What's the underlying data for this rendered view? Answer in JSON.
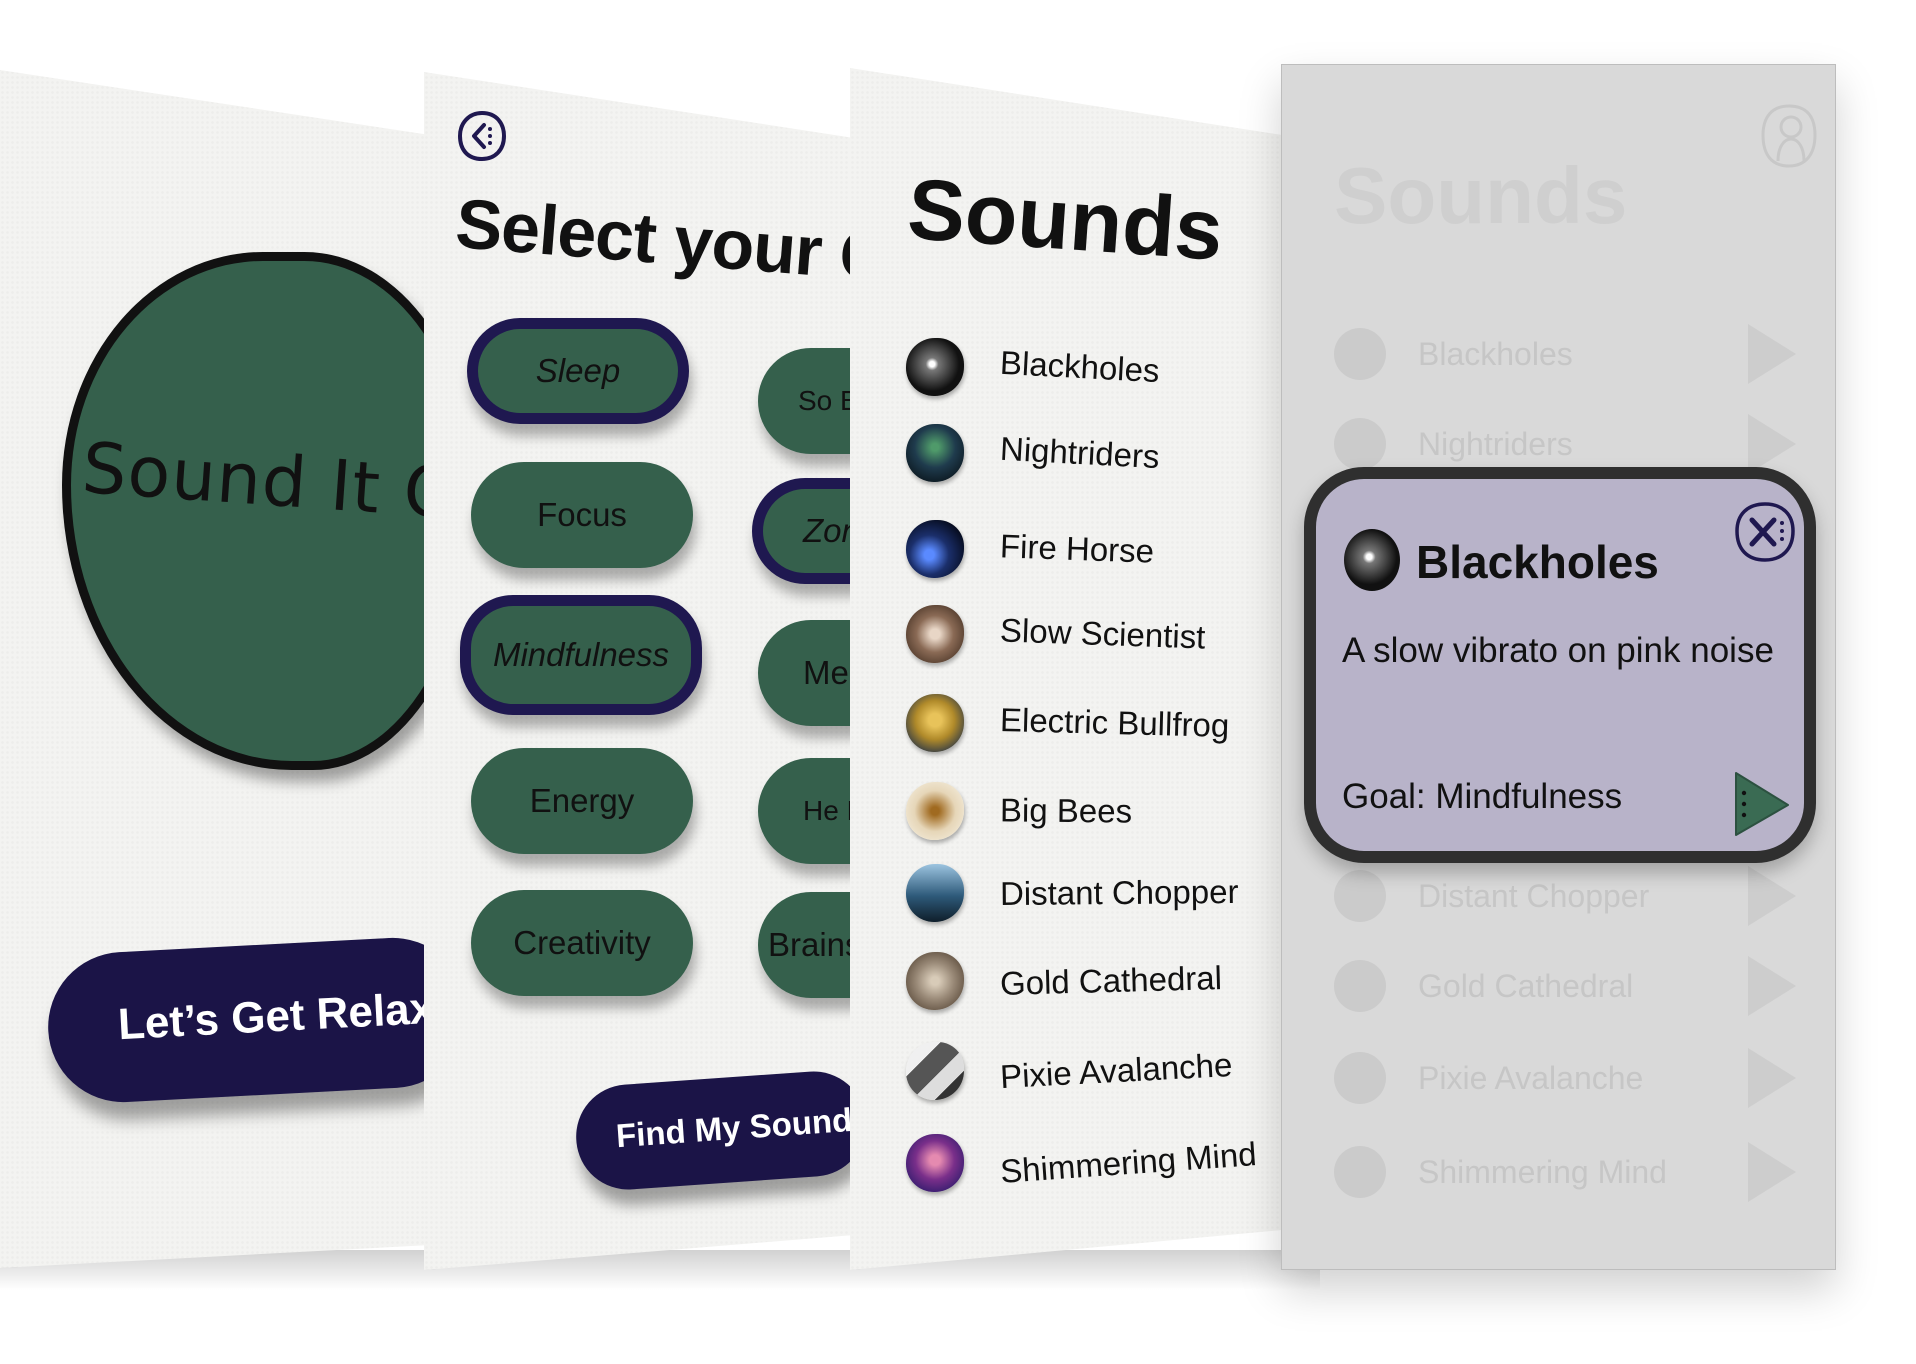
{
  "welcome": {
    "logo_text": "Sound It O",
    "cta_label": "Let’s Get Relaxin"
  },
  "goals": {
    "back_icon": "back-arrow-icon",
    "title": "Select your Go",
    "left_column": [
      {
        "label": "Sleep",
        "selected": true
      },
      {
        "label": "Focus",
        "selected": false
      },
      {
        "label": "Mindfulness",
        "selected": true
      },
      {
        "label": "Energy",
        "selected": false
      },
      {
        "label": "Creativity",
        "selected": false
      }
    ],
    "right_column": [
      {
        "label": "So Blo",
        "selected": false
      },
      {
        "label": "Zon",
        "selected": true
      },
      {
        "label": "Me",
        "selected": false
      },
      {
        "label": "He Bu",
        "selected": false
      },
      {
        "label": "Brains",
        "selected": false
      }
    ],
    "find_button": "Find My Sounds"
  },
  "sounds": {
    "title": "Sounds",
    "items": [
      {
        "name": "Blackholes",
        "color": "#1a1a1a"
      },
      {
        "name": "Nightriders",
        "color": "#1f3b4d"
      },
      {
        "name": "Fire Horse",
        "color": "#1b2f6b"
      },
      {
        "name": "Slow Scientist",
        "color": "#8a6a55"
      },
      {
        "name": "Electric Bullfrog",
        "color": "#b08a2a"
      },
      {
        "name": "Big Bees",
        "color": "#e6d6b8"
      },
      {
        "name": "Distant Chopper",
        "color": "#2e5a7a"
      },
      {
        "name": "Gold Cathedral",
        "color": "#9a8a78"
      },
      {
        "name": "Pixie Avalanche",
        "color": "#8a8a8a"
      },
      {
        "name": "Shimmering Mind",
        "color": "#7a2f8a"
      }
    ]
  },
  "detail": {
    "title": "Sounds",
    "profile_icon": "profile-icon",
    "dim_items": [
      "Blackholes",
      "Nightriders",
      "Distant Chopper",
      "Gold Cathedral",
      "Pixie Avalanche",
      "Shimmering Mind"
    ],
    "card": {
      "title": "Blackholes",
      "description": "A slow vibrato on pink noise",
      "goal": "Goal: Mindfulness",
      "close_icon": "close-icon",
      "play_icon": "play-icon",
      "accent": "#3a6b53"
    }
  }
}
